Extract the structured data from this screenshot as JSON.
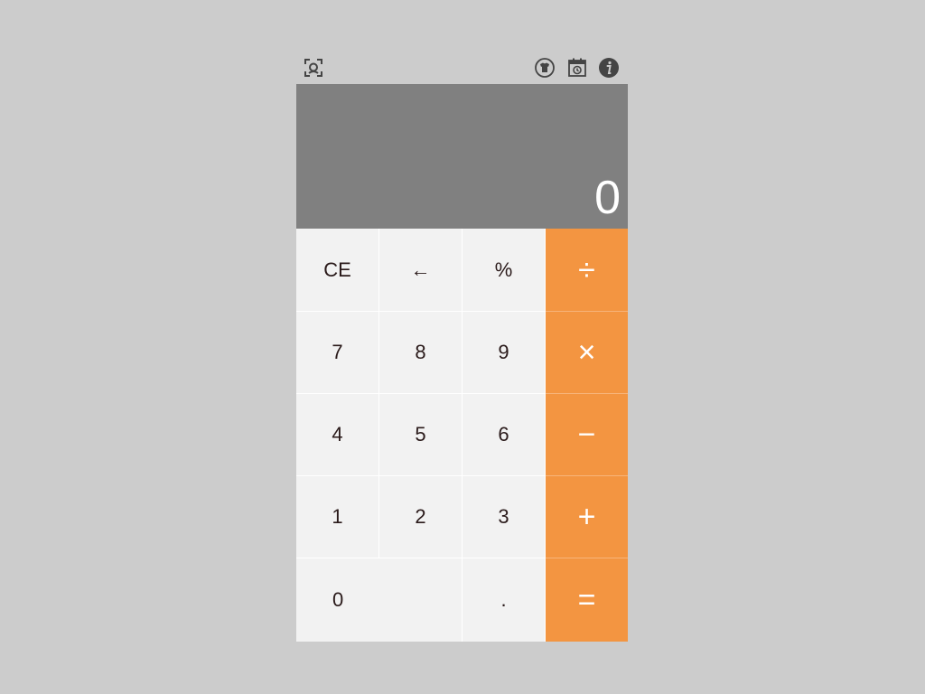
{
  "toolbar": {
    "left_icon": "screenshot-scan-icon",
    "right_icons": [
      "theme-shirt-icon",
      "history-calendar-icon",
      "info-icon"
    ]
  },
  "display": {
    "value": "0"
  },
  "keys": {
    "ce": "CE",
    "backspace": "←",
    "percent": "%",
    "divide": "÷",
    "seven": "7",
    "eight": "8",
    "nine": "9",
    "multiply": "×",
    "four": "4",
    "five": "5",
    "six": "6",
    "minus": "−",
    "one": "1",
    "two": "2",
    "three": "3",
    "plus": "+",
    "zero": "0",
    "decimal": ".",
    "equals": "="
  },
  "colors": {
    "background": "#cccccc",
    "display_bg": "#808080",
    "display_text": "#ffffff",
    "key_bg": "#f2f2f2",
    "key_text": "#2a1a1a",
    "operator_bg": "#f39541",
    "operator_text": "#ffffff"
  }
}
